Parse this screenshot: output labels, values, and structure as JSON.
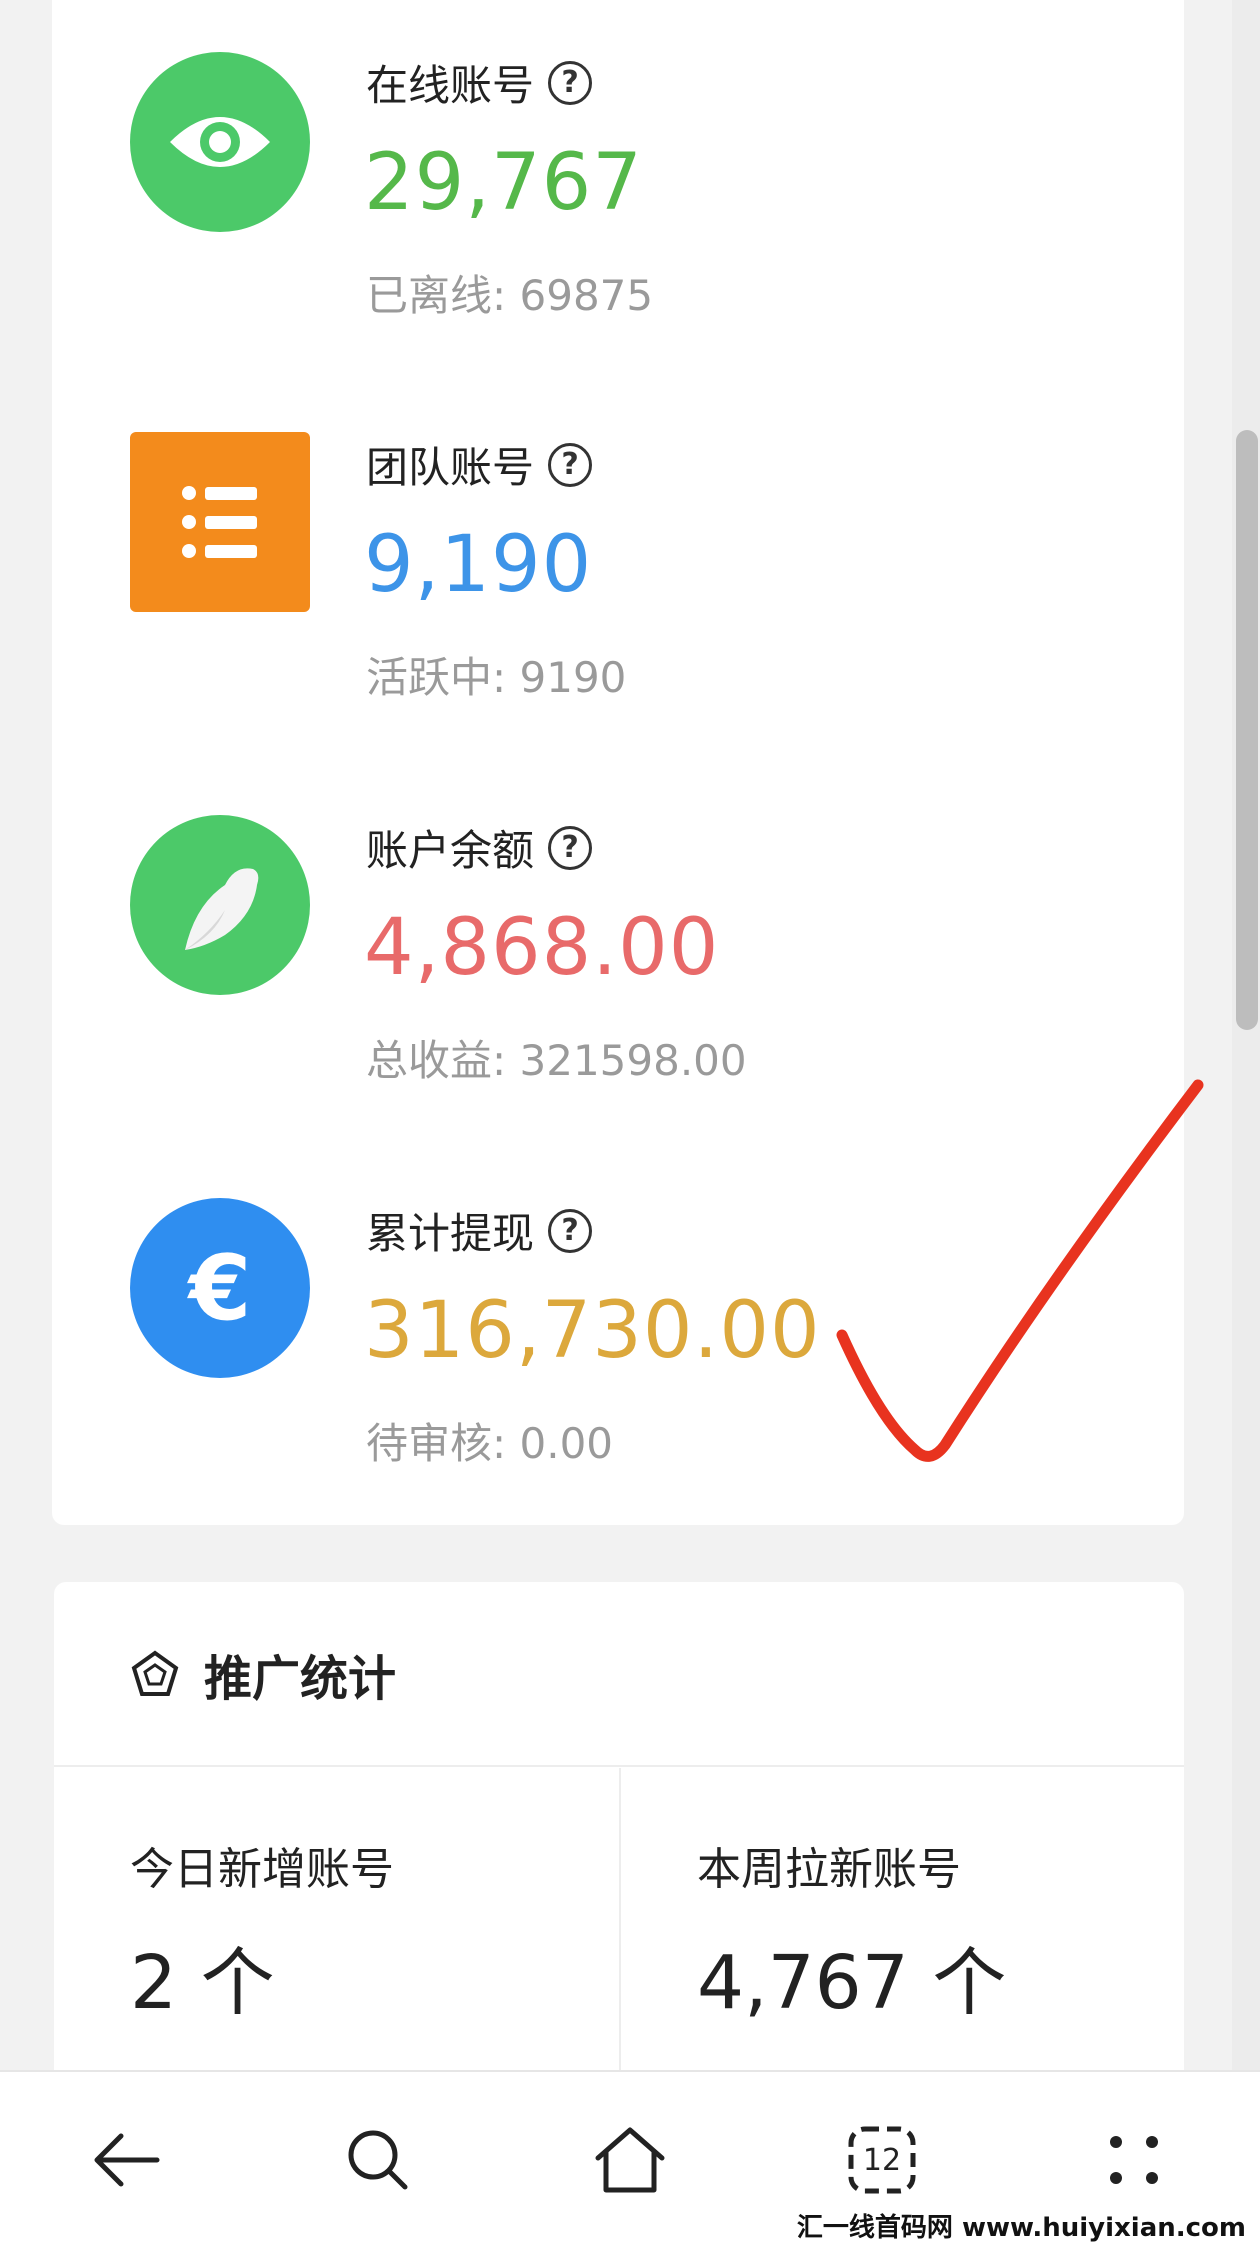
{
  "stats": [
    {
      "label": "在线账号",
      "value": "29,767",
      "sub": "已离线: 69875",
      "value_color": "#55b84a",
      "icon": "eye-icon",
      "icon_bg": "#4cc969"
    },
    {
      "label": "团队账号",
      "value": "9,190",
      "sub": "活跃中: 9190",
      "value_color": "#3d94e8",
      "icon": "list-icon",
      "icon_bg": "#f38b1c"
    },
    {
      "label": "账户余额",
      "value": "4,868.00",
      "sub": "总收益: 321598.00",
      "value_color": "#e86a6a",
      "icon": "bird-icon",
      "icon_bg": "#4cc969"
    },
    {
      "label": "累计提现",
      "value": "316,730.00",
      "sub": "待审核: 0.00",
      "value_color": "#dca83c",
      "icon": "euro-icon",
      "icon_bg": "#2f8ef0"
    }
  ],
  "help_glyph": "?",
  "euro_glyph": "€",
  "promo": {
    "title": "推广统计",
    "today_label": "今日新增账号",
    "today_value": "2 个",
    "week_label": "本周拉新账号",
    "week_value": "4,767 个"
  },
  "nav": {
    "tabs_count": "12"
  },
  "watermark": "汇一线首码网 www.huiyixian.com"
}
